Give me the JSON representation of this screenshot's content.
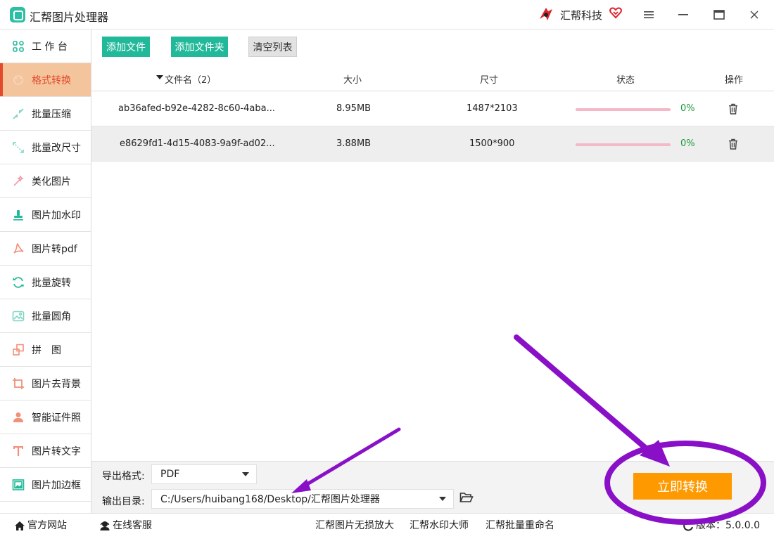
{
  "app": {
    "title": "汇帮图片处理器",
    "brand": "汇帮科技",
    "accent_color": "#22b99a",
    "active_color": "#e24a2c",
    "window_controls": [
      "menu-icon",
      "minimize-icon",
      "maximize-icon",
      "close-icon"
    ]
  },
  "sidebar": {
    "items": [
      {
        "label": "工 作 台",
        "icon": "workspace-icon",
        "active": false
      },
      {
        "label": "格式转换",
        "icon": "format-convert-icon",
        "active": true
      },
      {
        "label": "批量压缩",
        "icon": "compress-icon",
        "active": false
      },
      {
        "label": "批量改尺寸",
        "icon": "resize-icon",
        "active": false
      },
      {
        "label": "美化图片",
        "icon": "beautify-icon",
        "active": false
      },
      {
        "label": "图片加水印",
        "icon": "watermark-icon",
        "active": false
      },
      {
        "label": "图片转pdf",
        "icon": "pdf-icon",
        "active": false
      },
      {
        "label": "批量旋转",
        "icon": "rotate-icon",
        "active": false
      },
      {
        "label": "批量圆角",
        "icon": "round-corner-icon",
        "active": false
      },
      {
        "label": "拼　图",
        "icon": "collage-icon",
        "active": false
      },
      {
        "label": "图片去背景",
        "icon": "remove-bg-icon",
        "active": false
      },
      {
        "label": "智能证件照",
        "icon": "id-photo-icon",
        "active": false
      },
      {
        "label": "图片转文字",
        "icon": "ocr-text-icon",
        "active": false
      },
      {
        "label": "图片加边框",
        "icon": "border-icon",
        "active": false
      }
    ]
  },
  "toolbar": {
    "add_file": "添加文件",
    "add_folder": "添加文件夹",
    "clear_list": "清空列表"
  },
  "table": {
    "headers": {
      "filename": "文件名（2）",
      "size": "大小",
      "dimensions": "尺寸",
      "status": "状态",
      "actions": "操作"
    },
    "rows": [
      {
        "filename": "ab36afed-b92e-4282-8c60-4aba...",
        "size": "8.95MB",
        "dimensions": "1487*2103",
        "progress": 0,
        "progress_label": "0%"
      },
      {
        "filename": "e8629fd1-4d15-4083-9a9f-ad02...",
        "size": "3.88MB",
        "dimensions": "1500*900",
        "progress": 0,
        "progress_label": "0%"
      }
    ]
  },
  "bottom": {
    "format_label": "导出格式:",
    "format_value": "PDF",
    "output_label": "输出目录:",
    "output_value": "C:/Users/huibang168/Desktop/汇帮图片处理器",
    "convert_button": "立即转换"
  },
  "footer": {
    "website": "官方网站",
    "support": "在线客服",
    "links": [
      "汇帮图片无损放大",
      "汇帮水印大师",
      "汇帮批量重命名"
    ],
    "version": "版本：5.0.0.0"
  },
  "annotation_color": "#8a10c8"
}
